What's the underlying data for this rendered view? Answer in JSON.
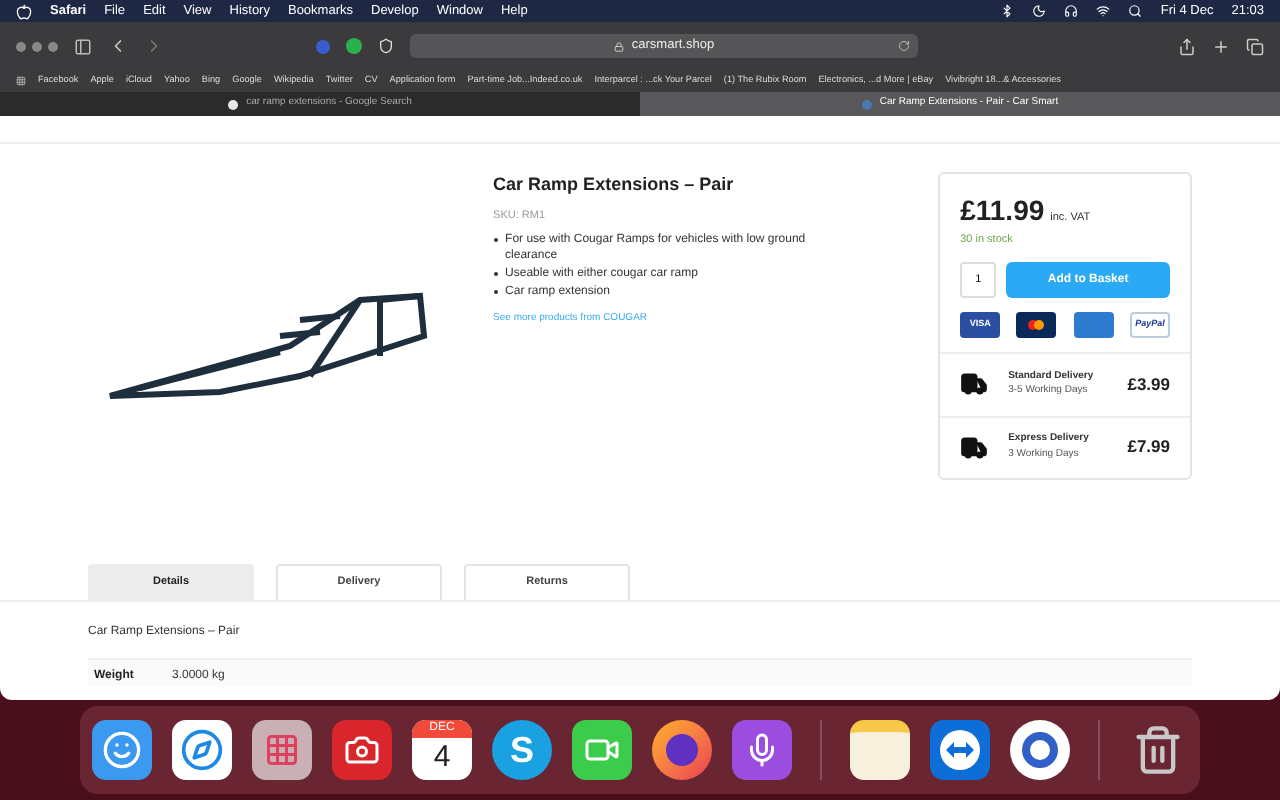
{
  "menubar": {
    "items": [
      "Safari",
      "File",
      "Edit",
      "View",
      "History",
      "Bookmarks",
      "Develop",
      "Window",
      "Help"
    ],
    "date": "Fri 4 Dec",
    "time": "21:03"
  },
  "browser": {
    "address": "carsmart.shop",
    "bookmarks": [
      "Facebook",
      "Apple",
      "iCloud",
      "Yahoo",
      "Bing",
      "Google",
      "Wikipedia",
      "Twitter",
      "CV",
      "Application form",
      "Part-time Job...Indeed.co.uk",
      "Interparcel : ...ck Your Parcel",
      "(1) The Rubix Room",
      "Electronics, ...d More | eBay",
      "Vivibright 18...& Accessories"
    ],
    "tabs": [
      {
        "label": "car ramp extensions - Google Search",
        "selected": false
      },
      {
        "label": "Car Ramp Extensions - Pair - Car Smart",
        "selected": true
      }
    ]
  },
  "product": {
    "title": "Car Ramp Extensions – Pair",
    "sku": "SKU: RM1",
    "bullets": [
      "For use with Cougar Ramps for vehicles with low ground clearance",
      "Useable with either cougar car ramp",
      "Car ramp extension"
    ],
    "more_link": "See more products from COUGAR",
    "price": "£11.99",
    "vat": "inc. VAT",
    "stock": "30 in stock",
    "quantity": "1",
    "add_button": "Add to Basket",
    "payments": [
      {
        "kind": "visa",
        "label": "VISA"
      },
      {
        "kind": "mastercard"
      },
      {
        "kind": "amex"
      },
      {
        "kind": "paypal",
        "label": "PayPal"
      }
    ],
    "delivery": [
      {
        "name": "Standard Delivery",
        "time": "3-5 Working Days",
        "price": "£3.99"
      },
      {
        "name": "Express Delivery",
        "time": "3 Working Days",
        "price": "£7.99"
      }
    ]
  },
  "tabs": [
    {
      "label": "Details",
      "selected": true
    },
    {
      "label": "Delivery",
      "selected": false
    },
    {
      "label": "Returns",
      "selected": false
    }
  ],
  "description": "Car Ramp Extensions – Pair",
  "specs": [
    {
      "label": "Weight",
      "value": "3.0000 kg"
    }
  ],
  "dock": [
    {
      "kind": "finder"
    },
    {
      "kind": "safari"
    },
    {
      "kind": "launchpad"
    },
    {
      "kind": "photobooth"
    },
    {
      "kind": "calendar",
      "month": "DEC",
      "day": "4"
    },
    {
      "kind": "skype",
      "label": "S"
    },
    {
      "kind": "facetime"
    },
    {
      "kind": "firefox"
    },
    {
      "kind": "podcasts"
    },
    {
      "kind": "separator"
    },
    {
      "kind": "notes"
    },
    {
      "kind": "teamviewer"
    },
    {
      "kind": "simplenote"
    },
    {
      "kind": "separator"
    },
    {
      "kind": "trash"
    }
  ]
}
